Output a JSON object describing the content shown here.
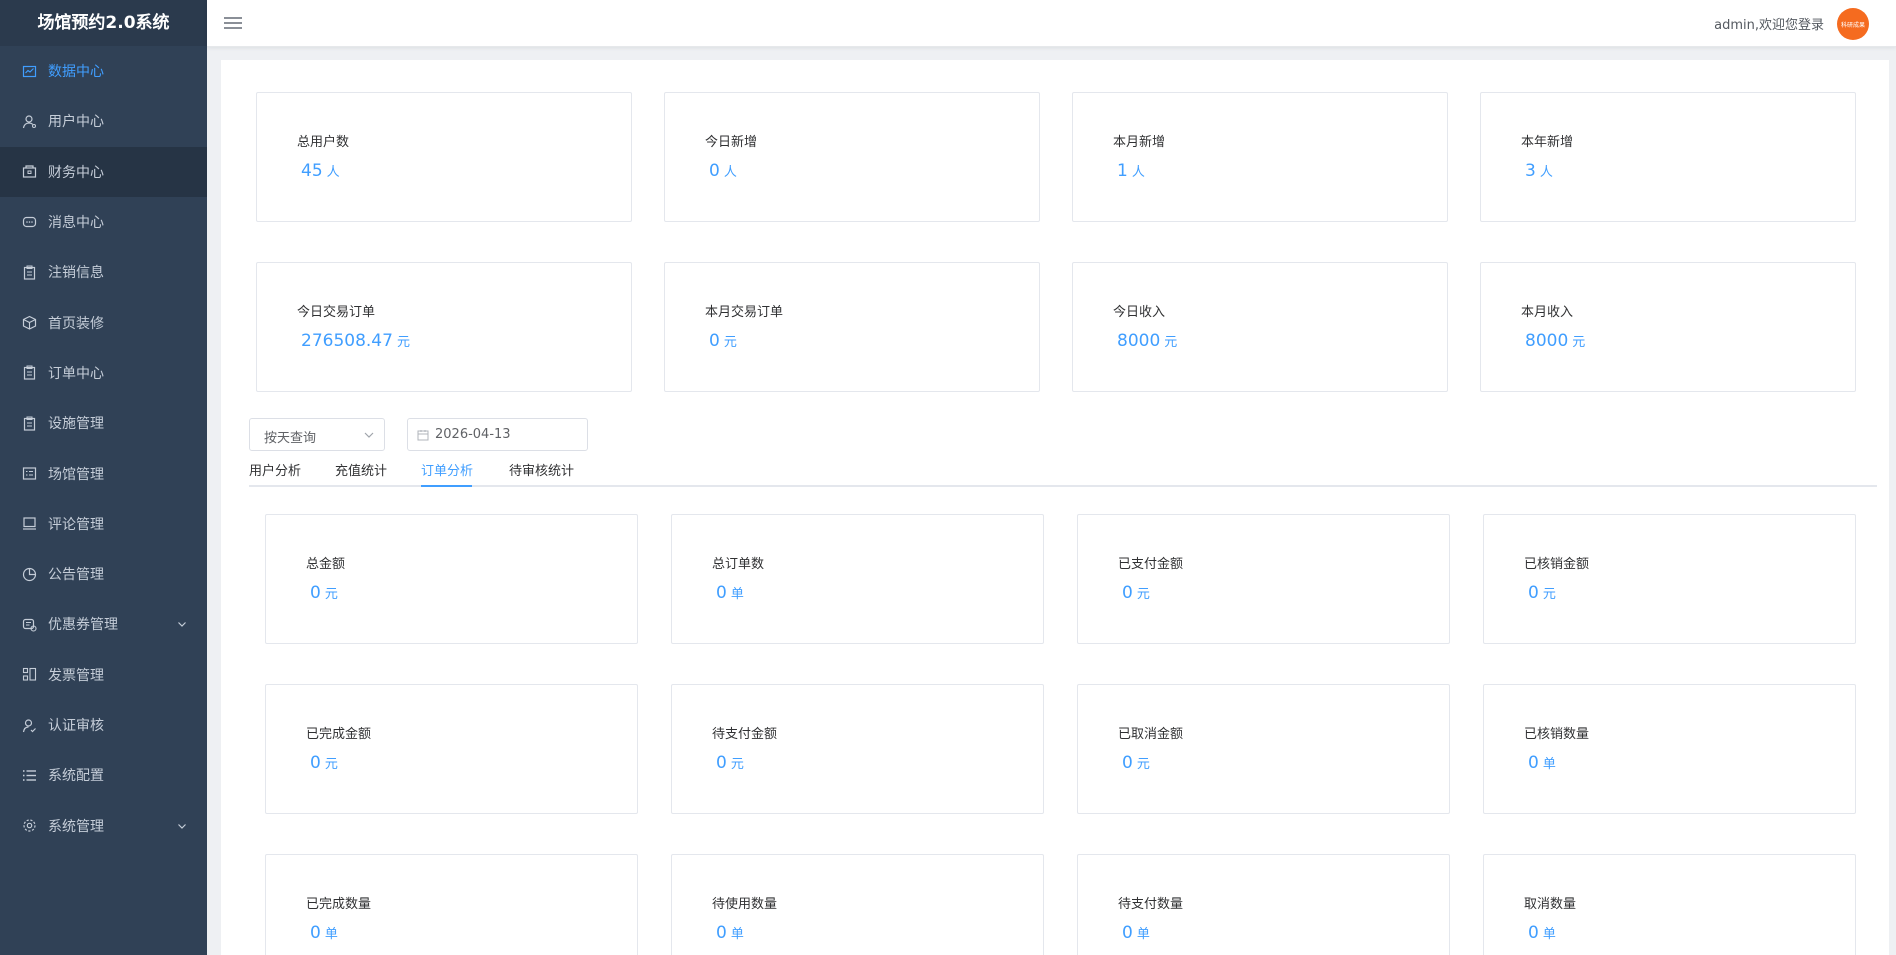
{
  "app": {
    "title": "场馆预约2.0系统"
  },
  "sidebar": {
    "items": [
      {
        "label": "数据中心",
        "icon": "chart-icon",
        "active": true
      },
      {
        "label": "用户中心",
        "icon": "user-icon"
      },
      {
        "label": "财务中心",
        "icon": "wallet-icon"
      },
      {
        "label": "消息中心",
        "icon": "message-icon"
      },
      {
        "label": "注销信息",
        "icon": "clipboard-icon"
      },
      {
        "label": "首页装修",
        "icon": "box-icon"
      },
      {
        "label": "订单中心",
        "icon": "clipboard-icon"
      },
      {
        "label": "设施管理",
        "icon": "clipboard-icon"
      },
      {
        "label": "场馆管理",
        "icon": "list-card-icon"
      },
      {
        "label": "评论管理",
        "icon": "monitor-icon"
      },
      {
        "label": "公告管理",
        "icon": "pie-icon"
      },
      {
        "label": "优惠券管理",
        "icon": "coupon-icon",
        "expandable": true
      },
      {
        "label": "发票管理",
        "icon": "grid-list-icon"
      },
      {
        "label": "认证审核",
        "icon": "user-check-icon"
      },
      {
        "label": "系统配置",
        "icon": "list-icon"
      },
      {
        "label": "系统管理",
        "icon": "gear-icon",
        "expandable": true
      }
    ]
  },
  "header": {
    "welcome": "admin,欢迎您登录",
    "avatar_text": "科研成果"
  },
  "user_stats": [
    {
      "label": "总用户数",
      "value": "45",
      "unit": "人"
    },
    {
      "label": "今日新增",
      "value": "0",
      "unit": "人"
    },
    {
      "label": "本月新增",
      "value": "1",
      "unit": "人"
    },
    {
      "label": "本年新增",
      "value": "3",
      "unit": "人"
    }
  ],
  "trade_stats": [
    {
      "label": "今日交易订单",
      "value": "276508.47",
      "unit": "元"
    },
    {
      "label": "本月交易订单",
      "value": "0",
      "unit": "元"
    },
    {
      "label": "今日收入",
      "value": "8000",
      "unit": "元"
    },
    {
      "label": "本月收入",
      "value": "8000",
      "unit": "元"
    }
  ],
  "filters": {
    "query_type": "按天查询",
    "date": "2026-04-13"
  },
  "tabs": [
    {
      "label": "用户分析"
    },
    {
      "label": "充值统计"
    },
    {
      "label": "订单分析",
      "active": true
    },
    {
      "label": "待审核统计"
    }
  ],
  "order_stats": [
    {
      "label": "总金额",
      "value": "0",
      "unit": "元"
    },
    {
      "label": "总订单数",
      "value": "0",
      "unit": "单"
    },
    {
      "label": "已支付金额",
      "value": "0",
      "unit": "元"
    },
    {
      "label": "已核销金额",
      "value": "0",
      "unit": "元"
    },
    {
      "label": "已完成金额",
      "value": "0",
      "unit": "元"
    },
    {
      "label": "待支付金额",
      "value": "0",
      "unit": "元"
    },
    {
      "label": "已取消金额",
      "value": "0",
      "unit": "元"
    },
    {
      "label": "已核销数量",
      "value": "0",
      "unit": "单"
    },
    {
      "label": "已完成数量",
      "value": "0",
      "unit": "单"
    },
    {
      "label": "待使用数量",
      "value": "0",
      "unit": "单"
    },
    {
      "label": "待支付数量",
      "value": "0",
      "unit": "单"
    },
    {
      "label": "取消数量",
      "value": "0",
      "unit": "单"
    }
  ],
  "colors": {
    "sidebar_bg": "#304156",
    "accent": "#409eff",
    "avatar_bg": "#f56b1f"
  }
}
